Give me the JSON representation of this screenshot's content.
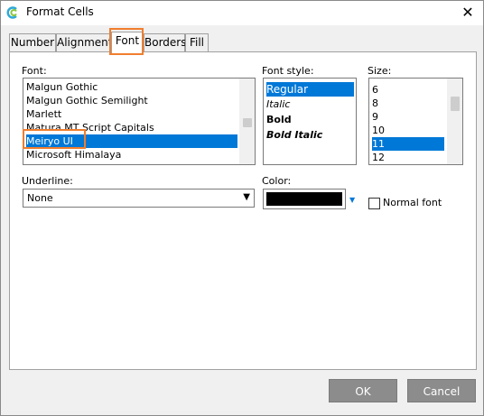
{
  "window": {
    "title": "Format Cells",
    "close_glyph": "✕"
  },
  "tabs": [
    {
      "label": "Number"
    },
    {
      "label": "Alignment"
    },
    {
      "label": "Font"
    },
    {
      "label": "Borders"
    },
    {
      "label": "Fill"
    }
  ],
  "font": {
    "label": "Font:",
    "items": [
      "Malgun Gothic",
      "Malgun Gothic Semilight",
      "Marlett",
      "Matura MT Script Capitals",
      "Meiryo UI",
      "Microsoft Himalaya"
    ],
    "selected": "Meiryo UI"
  },
  "font_style": {
    "label": "Font style:",
    "items": [
      "Regular",
      "Italic",
      "Bold",
      "Bold Italic"
    ],
    "selected": "Regular"
  },
  "size": {
    "label": "Size:",
    "items": [
      "6",
      "8",
      "9",
      "10",
      "11",
      "12"
    ],
    "selected": "11"
  },
  "underline": {
    "label": "Underline:",
    "value": "None",
    "arrow": "▼"
  },
  "color": {
    "label": "Color:",
    "value": "#000000",
    "arrow": "▼"
  },
  "normal_font": {
    "label": "Normal font",
    "checked": false
  },
  "buttons": {
    "ok": "OK",
    "cancel": "Cancel"
  },
  "colors": {
    "selection": "#0078d7",
    "highlight_outline": "#f07e2e",
    "button_bg": "#8c8c8c"
  }
}
